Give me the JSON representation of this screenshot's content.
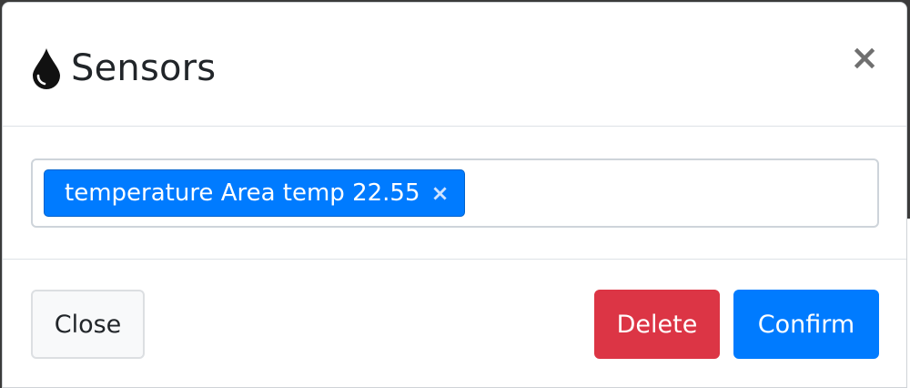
{
  "modal": {
    "title": "Sensors",
    "title_icon": "water-drop-icon",
    "close_glyph": "×"
  },
  "selection": {
    "tags": [
      {
        "label": "temperature Area temp 22.55",
        "remove_glyph": "×"
      }
    ]
  },
  "footer": {
    "close_label": "Close",
    "delete_label": "Delete",
    "confirm_label": "Confirm"
  },
  "colors": {
    "primary": "#007bff",
    "danger": "#dc3545",
    "light": "#f8f9fa"
  }
}
